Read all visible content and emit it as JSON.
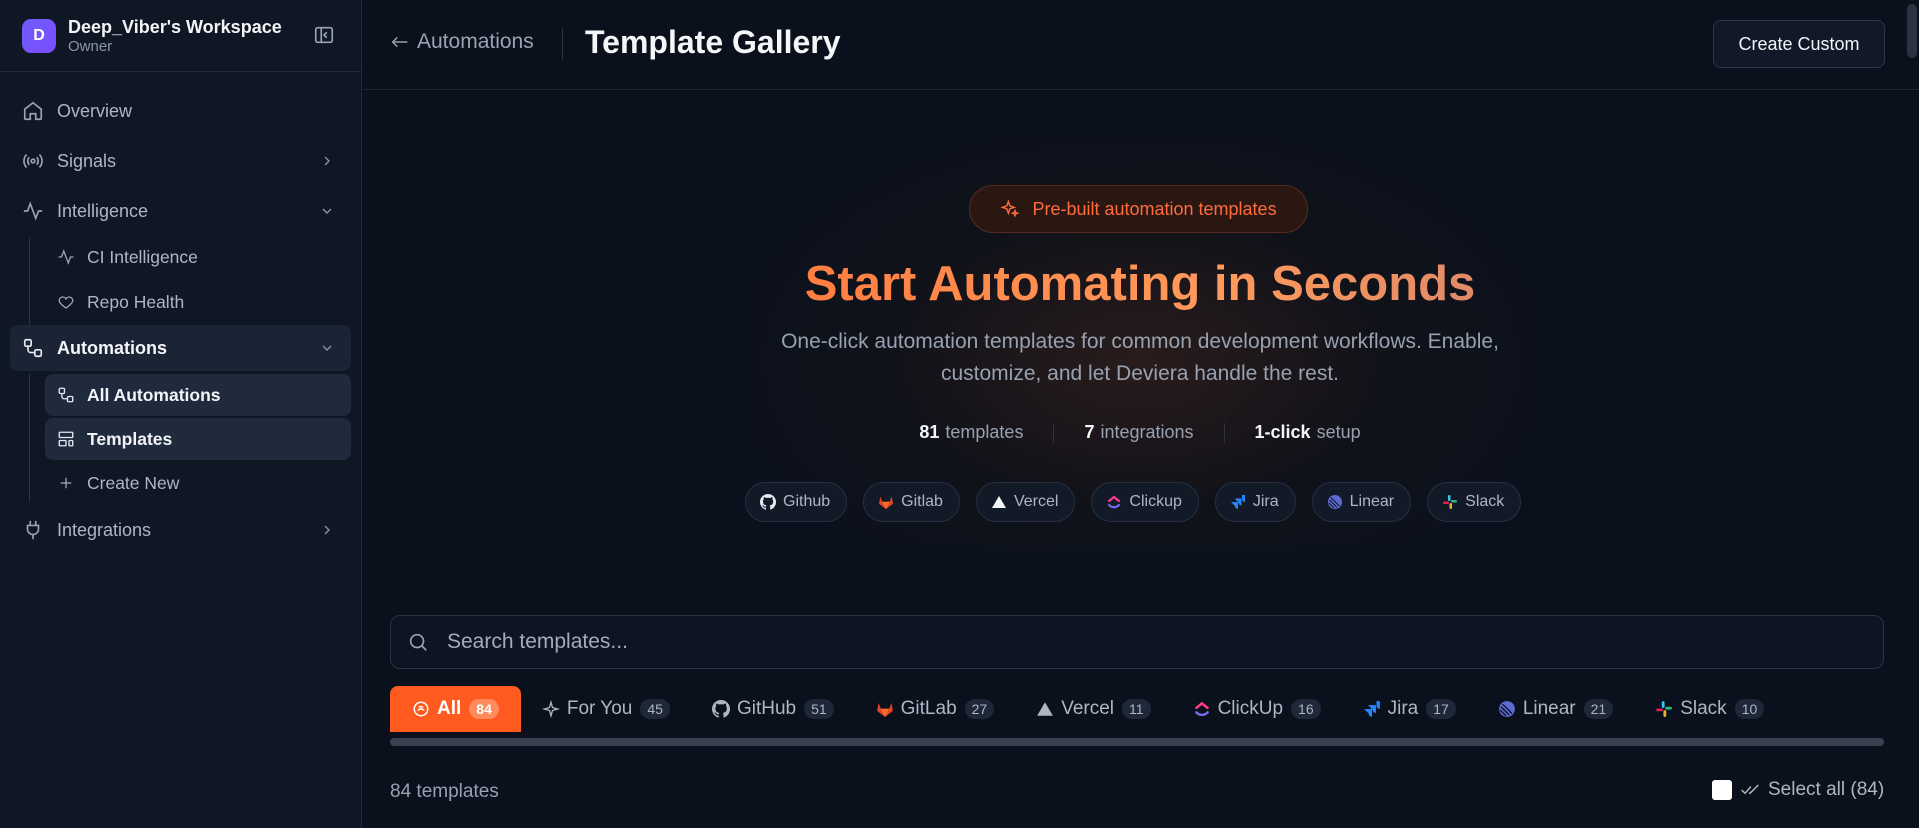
{
  "workspace": {
    "avatar_letter": "D",
    "name": "Deep_Viber's Workspace",
    "role": "Owner"
  },
  "sidebar": {
    "items": [
      {
        "label": "Overview",
        "icon": "home-icon"
      },
      {
        "label": "Signals",
        "icon": "radio-icon"
      },
      {
        "label": "Intelligence",
        "icon": "activity-icon"
      },
      {
        "label": "CI Intelligence",
        "icon": "activity-icon"
      },
      {
        "label": "Repo Health",
        "icon": "heart-icon"
      },
      {
        "label": "Automations",
        "icon": "workflow-icon"
      },
      {
        "label": "All Automations",
        "icon": "workflow-icon"
      },
      {
        "label": "Templates",
        "icon": "layout-template-icon"
      },
      {
        "label": "Create New",
        "icon": "plus-icon"
      },
      {
        "label": "Integrations",
        "icon": "plug-icon"
      }
    ]
  },
  "header": {
    "back_label": "Automations",
    "title": "Template Gallery",
    "create_button": "Create Custom"
  },
  "hero": {
    "pill": "Pre-built automation templates",
    "title": "Start Automating in Seconds",
    "subtitle_line1": "One-click automation templates for common development workflows. Enable,",
    "subtitle_line2": "customize, and let Deviera handle the rest.",
    "stats": [
      {
        "value": "81",
        "label": "templates"
      },
      {
        "value": "7",
        "label": "integrations"
      },
      {
        "value": "1-click",
        "label": "setup"
      }
    ],
    "integrations": [
      "Github",
      "Gitlab",
      "Vercel",
      "Clickup",
      "Jira",
      "Linear",
      "Slack"
    ]
  },
  "search": {
    "placeholder": "Search templates..."
  },
  "tabs": [
    {
      "label": "All",
      "count": "84"
    },
    {
      "label": "For You",
      "count": "45"
    },
    {
      "label": "GitHub",
      "count": "51"
    },
    {
      "label": "GitLab",
      "count": "27"
    },
    {
      "label": "Vercel",
      "count": "11"
    },
    {
      "label": "ClickUp",
      "count": "16"
    },
    {
      "label": "Jira",
      "count": "17"
    },
    {
      "label": "Linear",
      "count": "21"
    },
    {
      "label": "Slack",
      "count": "10"
    }
  ],
  "results": {
    "count_text": "84 templates",
    "select_all": "Select all (84)"
  },
  "colors": {
    "accent": "#ff5a1f",
    "background": "#0b111c",
    "sidebar": "#0f1724"
  }
}
